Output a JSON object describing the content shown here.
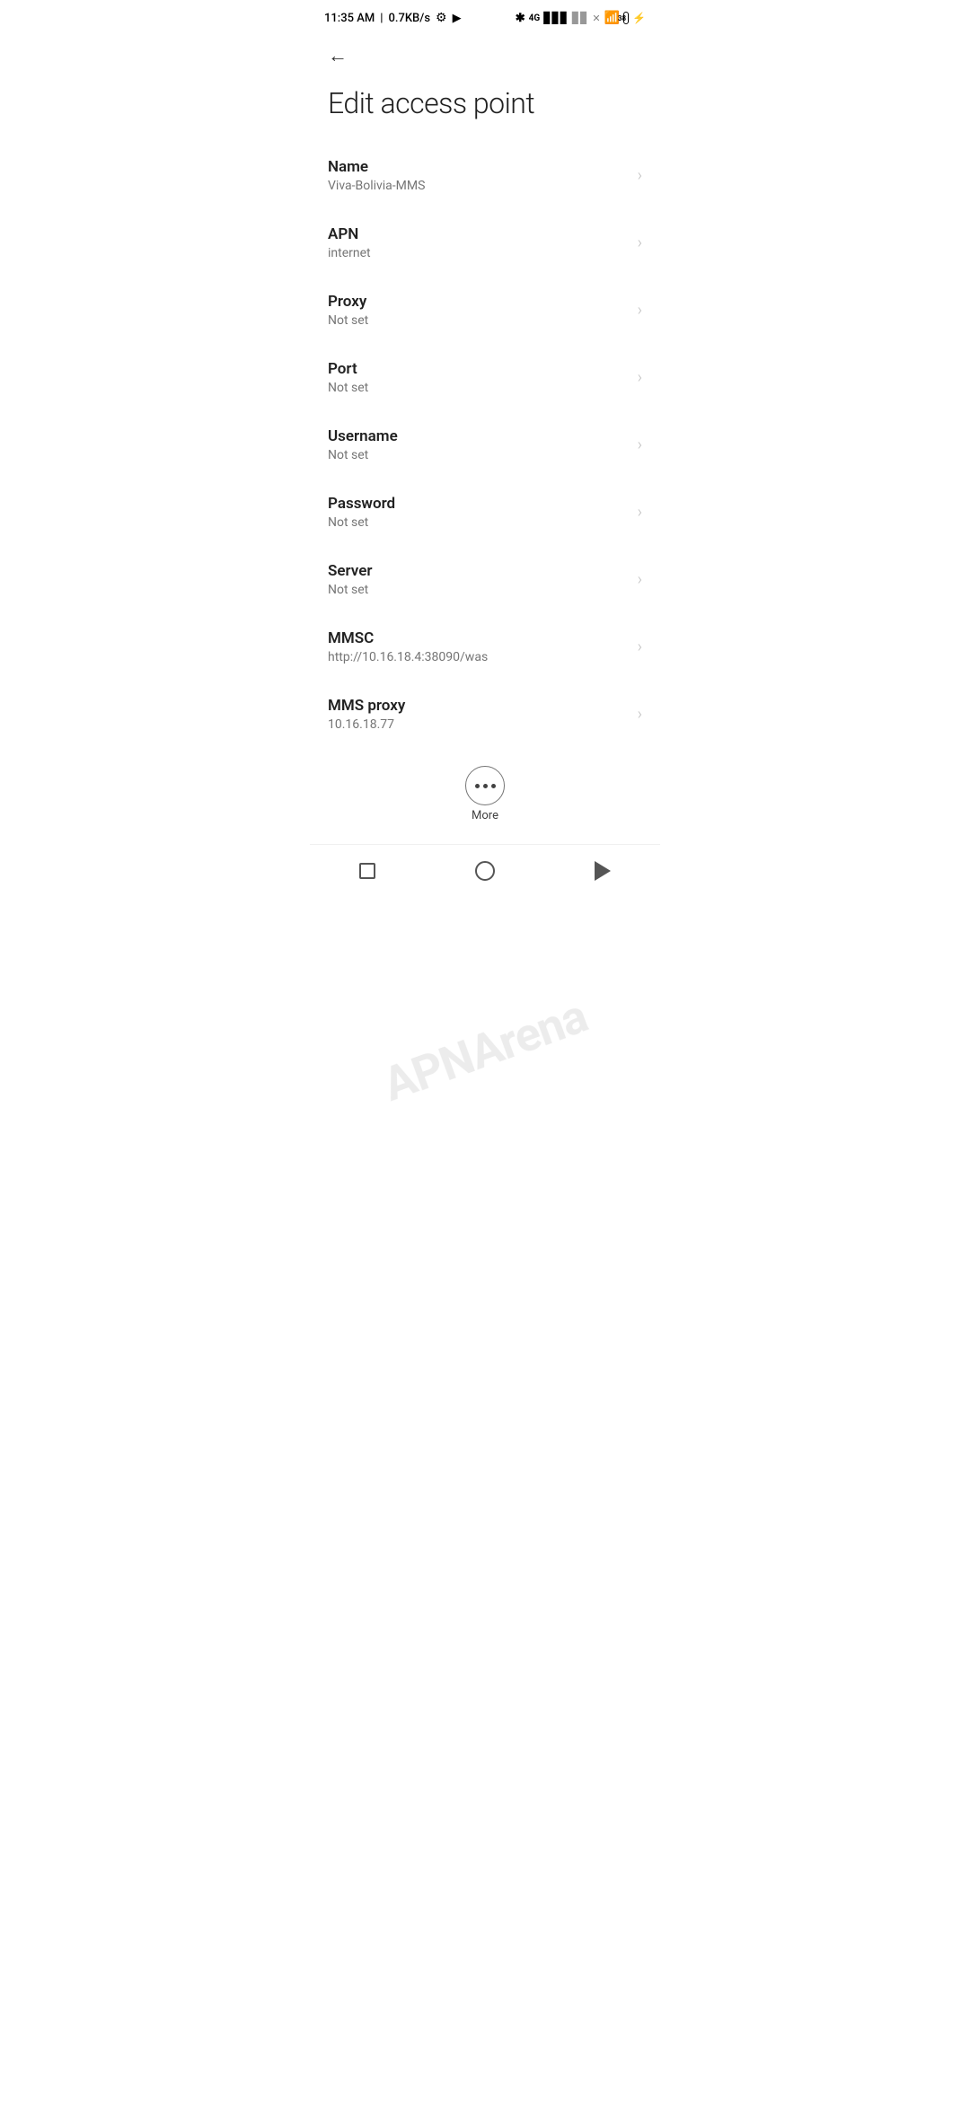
{
  "status_bar": {
    "time": "11:35 AM",
    "network_speed": "0.7KB/s"
  },
  "toolbar": {
    "back_label": "←"
  },
  "page": {
    "title": "Edit access point"
  },
  "settings_items": [
    {
      "id": "name",
      "label": "Name",
      "value": "Viva-Bolivia-MMS"
    },
    {
      "id": "apn",
      "label": "APN",
      "value": "internet"
    },
    {
      "id": "proxy",
      "label": "Proxy",
      "value": "Not set"
    },
    {
      "id": "port",
      "label": "Port",
      "value": "Not set"
    },
    {
      "id": "username",
      "label": "Username",
      "value": "Not set"
    },
    {
      "id": "password",
      "label": "Password",
      "value": "Not set"
    },
    {
      "id": "server",
      "label": "Server",
      "value": "Not set"
    },
    {
      "id": "mmsc",
      "label": "MMSC",
      "value": "http://10.16.18.4:38090/was"
    },
    {
      "id": "mms_proxy",
      "label": "MMS proxy",
      "value": "10.16.18.77"
    }
  ],
  "more_button": {
    "label": "More"
  },
  "watermark": {
    "text": "APNArena"
  }
}
